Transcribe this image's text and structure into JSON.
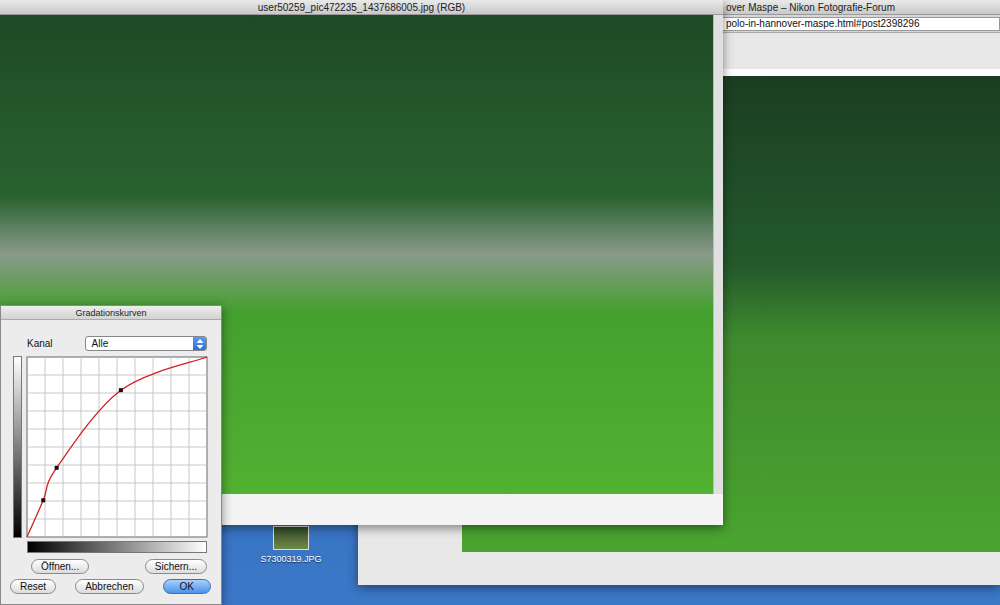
{
  "desktop": {
    "file": {
      "name": "S7300319.JPG"
    }
  },
  "browser": {
    "title": "over Maspe – Nikon Fotografie-Forum",
    "url": "polo-in-hannover-maspe.html#post2398296"
  },
  "image_window": {
    "title": "user50259_pic472235_1437686005.jpg (RGB)"
  },
  "curves_dialog": {
    "title": "Gradationskurven",
    "channel_label": "Kanal",
    "channel": "Alle",
    "curve": {
      "points": [
        [
          0,
          0
        ],
        [
          23,
          52
        ],
        [
          42,
          98
        ],
        [
          133,
          208
        ],
        [
          255,
          255
        ]
      ]
    },
    "file_buttons": [
      {
        "label": "Öffnen...",
        "default": false
      },
      {
        "label": "Sichern...",
        "default": false
      }
    ],
    "action_buttons": [
      {
        "label": "Reset",
        "default": false
      },
      {
        "label": "Abbrechen",
        "default": false
      },
      {
        "label": "OK",
        "default": true
      }
    ]
  }
}
